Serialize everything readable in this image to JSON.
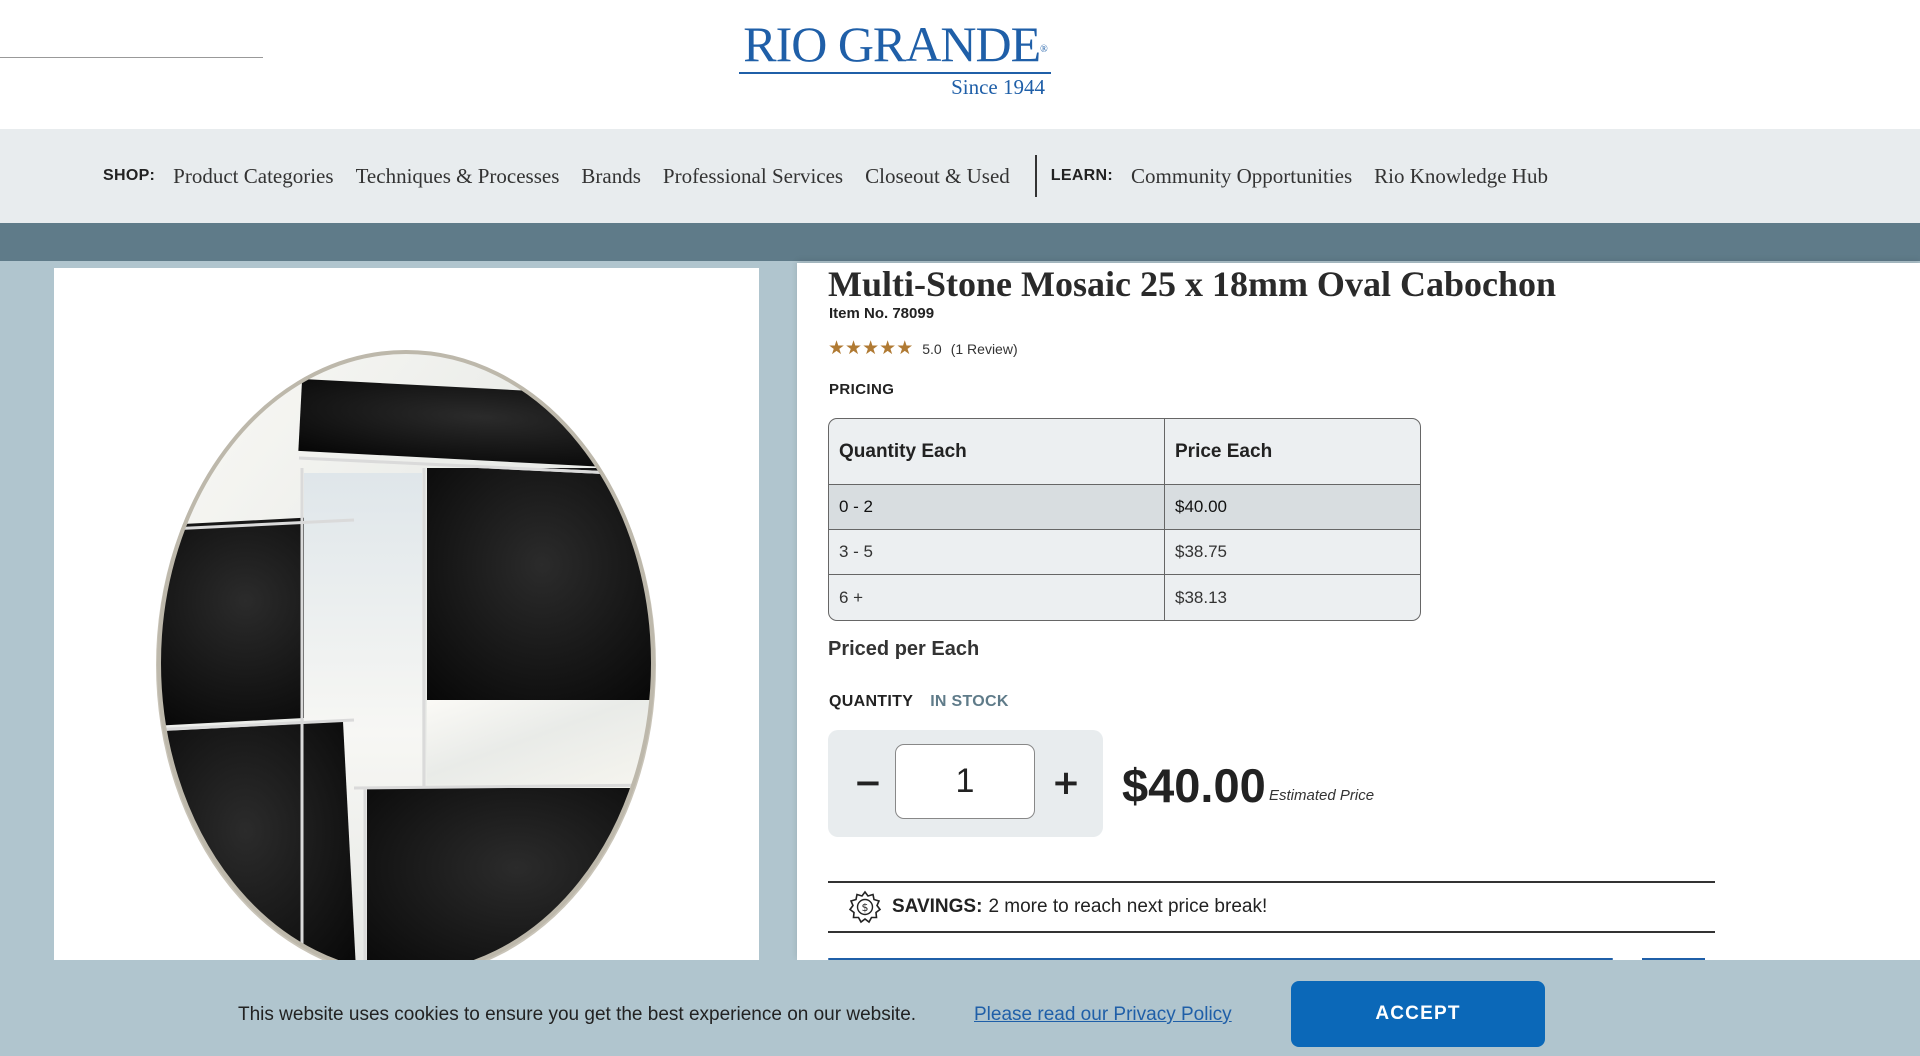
{
  "header": {
    "logo_text": "RIO GRANDE",
    "logo_reg": "®",
    "logo_tagline": "Since 1944"
  },
  "nav": {
    "shop_label": "SHOP:",
    "shop_items": [
      "Product Categories",
      "Techniques & Processes",
      "Brands",
      "Professional Services",
      "Closeout & Used"
    ],
    "learn_label": "LEARN:",
    "learn_items": [
      "Community Opportunities",
      "Rio Knowledge Hub"
    ]
  },
  "product": {
    "title": "Multi-Stone Mosaic 25 x 18mm Oval Cabochon",
    "item_no": "Item No. 78099",
    "rating_value": "5.0",
    "rating_stars": 5,
    "review_count": "(1 Review)",
    "pricing_label": "PRICING",
    "pricing_table": {
      "headers": [
        "Quantity Each",
        "Price Each"
      ],
      "rows": [
        [
          "0 - 2",
          "$40.00"
        ],
        [
          "3 - 5",
          "$38.75"
        ],
        [
          "6 +",
          "$38.13"
        ]
      ]
    },
    "priced_per": "Priced per Each",
    "quantity_label": "QUANTITY",
    "stock_status": "IN STOCK",
    "quantity_value": "1",
    "minus_label": "−",
    "plus_label": "+",
    "estimated_price": "$40.00",
    "estimated_label": "Estimated Price",
    "savings_label": "SAVINGS:",
    "savings_text": "2 more to reach next price break!"
  },
  "cookie": {
    "message": "This website uses cookies to ensure you get the best experience on our website.",
    "policy_link": "Please read our Privacy Policy",
    "accept_label": "ACCEPT"
  },
  "colors": {
    "brand_blue": "#1f5fa8",
    "accept_blue": "#0b68b8",
    "band": "#5f7b89",
    "background": "#b0c5ce",
    "star": "#b07a33"
  }
}
